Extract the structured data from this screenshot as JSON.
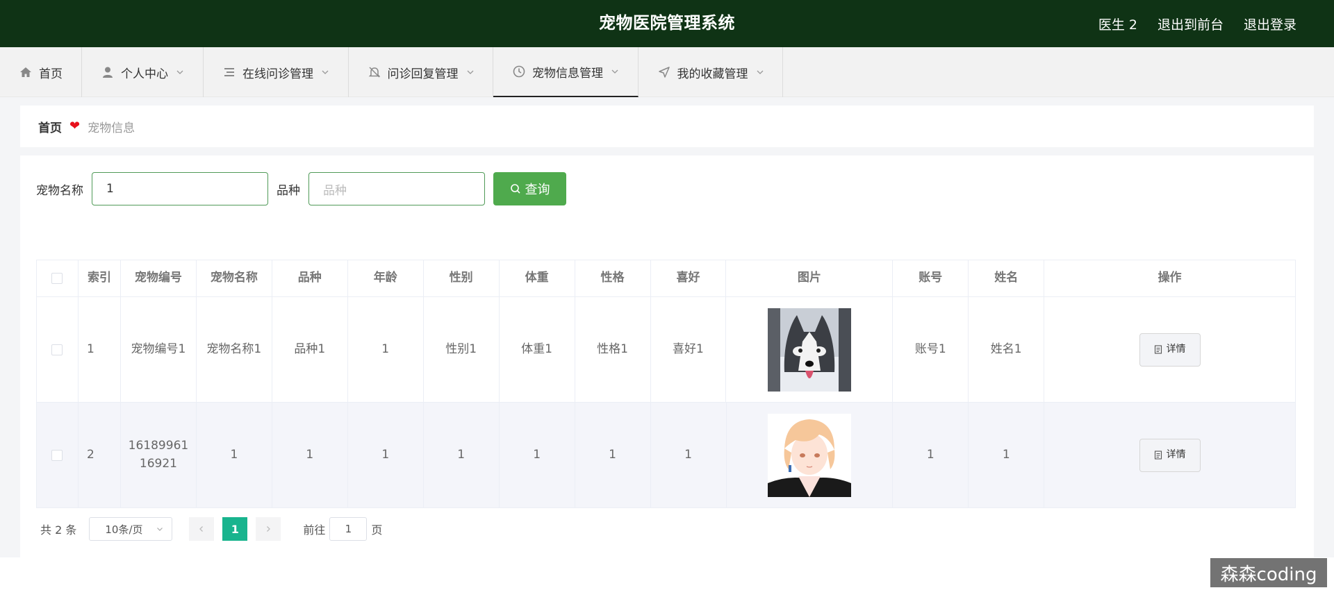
{
  "header": {
    "title": "宠物医院管理系统",
    "user": "医生 2",
    "to_front": "退出到前台",
    "logout": "退出登录"
  },
  "nav": [
    {
      "label": "首页",
      "icon": "home-icon"
    },
    {
      "label": "个人中心",
      "icon": "user-icon"
    },
    {
      "label": "在线问诊管理",
      "icon": "list-icon"
    },
    {
      "label": "问诊回复管理",
      "icon": "bell-off-icon"
    },
    {
      "label": "宠物信息管理",
      "icon": "clock-icon"
    },
    {
      "label": "我的收藏管理",
      "icon": "navigation-icon"
    }
  ],
  "breadcrumb": {
    "home": "首页",
    "current": "宠物信息",
    "separator_icon": "heart-icon"
  },
  "search": {
    "name_label": "宠物名称",
    "name_value": "1",
    "breed_label": "品种",
    "breed_placeholder": "品种",
    "button_label": "查询"
  },
  "table": {
    "columns": [
      "索引",
      "宠物编号",
      "宠物名称",
      "品种",
      "年龄",
      "性别",
      "体重",
      "性格",
      "喜好",
      "图片",
      "账号",
      "姓名",
      "操作"
    ],
    "rows": [
      {
        "index": "1",
        "code": "宠物编号1",
        "name": "宠物名称1",
        "breed": "品种1",
        "age": "1",
        "gender": "性别1",
        "weight": "体重1",
        "temper": "性格1",
        "hobby": "喜好1",
        "image": "husky-dog-photo",
        "account": "账号1",
        "realname": "姓名1",
        "action": "详情"
      },
      {
        "index": "2",
        "code": "16189961 16921",
        "name": "1",
        "breed": "1",
        "age": "1",
        "gender": "1",
        "weight": "1",
        "temper": "1",
        "hobby": "1",
        "image": "anime-boy-avatar",
        "account": "1",
        "realname": "1",
        "action": "详情"
      }
    ]
  },
  "pagination": {
    "total": "共 2 条",
    "page_size": "10条/页",
    "current": "1",
    "goto_prefix": "前往",
    "goto_value": "1",
    "goto_suffix": "页"
  },
  "watermark": "森森coding",
  "colors": {
    "header_bg": "#0f3315",
    "accent": "#4faa4d",
    "page_active": "#19b48e",
    "heart": "#e8101c"
  }
}
